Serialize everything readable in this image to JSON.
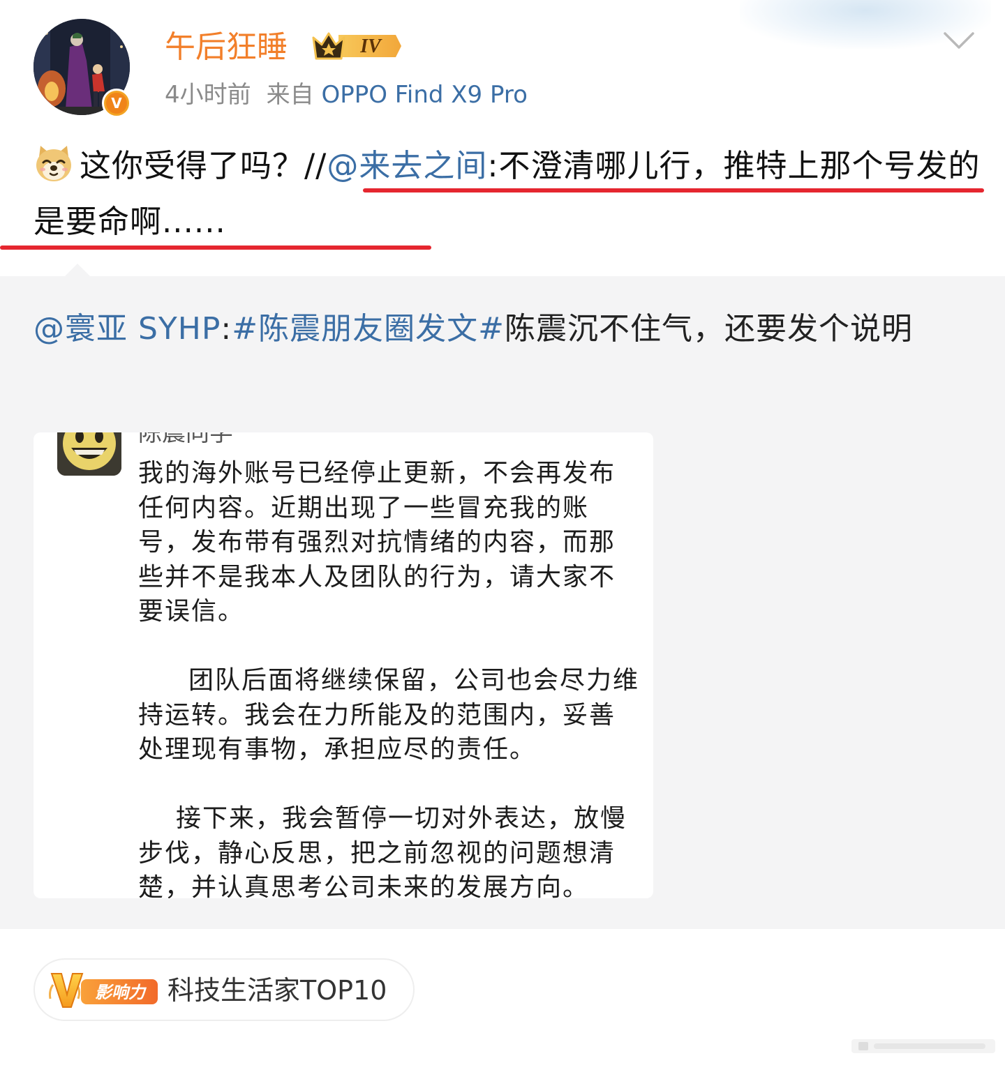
{
  "post": {
    "username": "午后狂睡",
    "level_badge": "IV",
    "timestamp": "4小时前",
    "source_prefix": "来自",
    "device": "OPPO Find X9 Pro",
    "repost_text_before": "这你受得了吗？//",
    "repost_mention": "@来去之间",
    "repost_text_after": ":不澄清哪儿行，推特上那个号发的是要命啊......"
  },
  "quoted": {
    "mention": "@寰亚 SYHP",
    "separator": ":",
    "topic": "#陈震朋友圈发文#",
    "text": "陈震沉不住气，还要发个说明",
    "screenshot": {
      "name": "陈震同学",
      "paragraph1": "我的海外账号已经停止更新，不会再发布任何内容。近期出现了一些冒充我的账号，发布带有强烈对抗情绪的内容，而那些并不是我本人及团队的行为，请大家不要误信。",
      "paragraph2": "团队后面将继续保留，公司也会尽力维持运转。我会在力所能及的范围内，妥善处理现有事物，承担应尽的责任。",
      "paragraph3": "接下来，我会暂停一切对外表达，放慢步伐，静心反思，把之前忽视的问题想清楚，并认真思考公司未来的发展方向。"
    }
  },
  "influence": {
    "logo_text": "影响力",
    "label": "科技生活家TOP10"
  },
  "colors": {
    "username": "#f27f2a",
    "link": "#3b6ea5",
    "underline": "#e5262f",
    "quoted_bg": "#f4f4f5"
  },
  "icons": {
    "expand": "chevron-down-icon",
    "verified": "verified-v-icon",
    "crown": "crown-icon",
    "emoji": "doge-emoji-icon"
  }
}
